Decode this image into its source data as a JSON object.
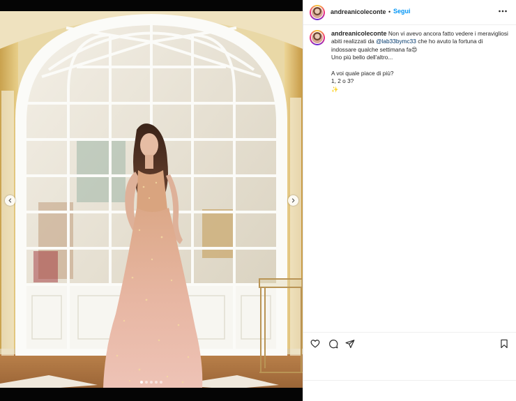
{
  "post": {
    "author": "andreanicoleconte",
    "separator": "•",
    "follow_label": "Segui",
    "caption": {
      "text_before_mention": "Non vi avevo ancora fatto vedere i meravigliosi abiti realizzati da",
      "mention": "@lab33bymc33",
      "text_after_mention": "che ho avuto la fortuna di indossare qualche settimana fa😍",
      "line2": "Uno più bello dell'altro...",
      "line3": "A voi quale piace di più?",
      "line4": "1, 2 o 3?",
      "line5": "✨"
    }
  },
  "carousel": {
    "slide_count": 5,
    "active_slide": 1
  },
  "icons": {
    "more": "more-options-icon",
    "like": "heart-icon",
    "comment": "comment-icon",
    "share": "send-icon",
    "save": "bookmark-icon",
    "prev": "chevron-left-icon",
    "next": "chevron-right-icon"
  },
  "colors": {
    "follow": "#0095f6",
    "mention": "#00376b",
    "text": "#262626"
  }
}
